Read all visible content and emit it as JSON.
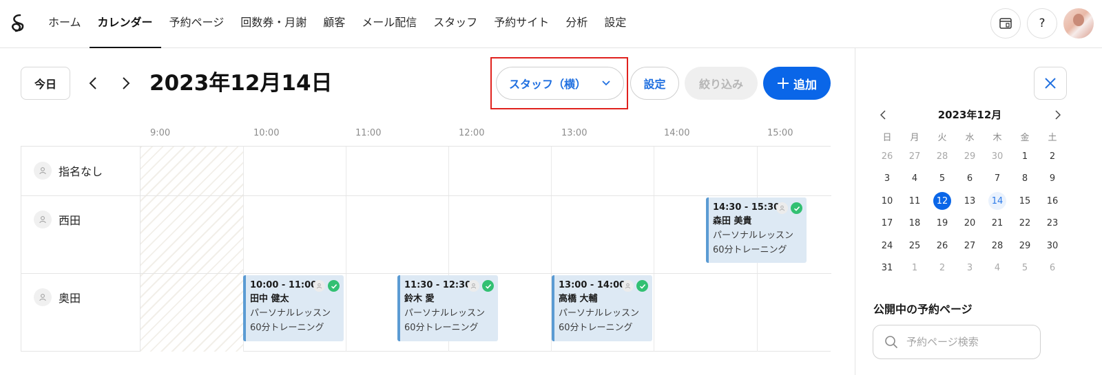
{
  "nav": {
    "items": [
      {
        "label": "ホーム",
        "active": false
      },
      {
        "label": "カレンダー",
        "active": true
      },
      {
        "label": "予約ページ",
        "active": false
      },
      {
        "label": "回数券・月謝",
        "active": false
      },
      {
        "label": "顧客",
        "active": false
      },
      {
        "label": "メール配信",
        "active": false
      },
      {
        "label": "スタッフ",
        "active": false
      },
      {
        "label": "予約サイト",
        "active": false
      },
      {
        "label": "分析",
        "active": false
      },
      {
        "label": "設定",
        "active": false
      }
    ],
    "help_label": "?",
    "icons": [
      "logo-icon",
      "browser-window-icon",
      "help-icon",
      "user-avatar"
    ]
  },
  "toolbar": {
    "today_label": "今日",
    "date_title": "2023年12月14日",
    "view_select": "スタッフ（横）",
    "settings_label": "設定",
    "filter_label": "絞り込み",
    "add_label": "追加"
  },
  "timeline": {
    "hours": [
      "9:00",
      "10:00",
      "11:00",
      "12:00",
      "13:00",
      "14:00",
      "15:00"
    ],
    "staff": [
      "指名なし",
      "西田",
      "奥田"
    ],
    "events": [
      {
        "staff": "西田",
        "time": "14:30 - 15:30",
        "customer": "森田 美貴",
        "line1": "パーソナルレッスン",
        "line2": "60分トレーニング",
        "confirmed": true
      },
      {
        "staff": "奥田",
        "time": "10:00 - 11:00",
        "customer": "田中 健太",
        "line1": "パーソナルレッスン",
        "line2": "60分トレーニング",
        "confirmed": true
      },
      {
        "staff": "奥田",
        "time": "11:30 - 12:30",
        "customer": "鈴木 愛",
        "line1": "パーソナルレッスン",
        "line2": "60分トレーニング",
        "confirmed": true
      },
      {
        "staff": "奥田",
        "time": "13:00 - 14:00",
        "customer": "高橋 大輔",
        "line1": "パーソナルレッスン",
        "line2": "60分トレーニング",
        "confirmed": true
      }
    ]
  },
  "mini_calendar": {
    "title": "2023年12月",
    "weekdays": [
      "日",
      "月",
      "火",
      "水",
      "木",
      "金",
      "土"
    ],
    "weeks": [
      [
        "26",
        "27",
        "28",
        "29",
        "30",
        "1",
        "2"
      ],
      [
        "3",
        "4",
        "5",
        "6",
        "7",
        "8",
        "9"
      ],
      [
        "10",
        "11",
        "12",
        "13",
        "14",
        "15",
        "16"
      ],
      [
        "17",
        "18",
        "19",
        "20",
        "21",
        "22",
        "23"
      ],
      [
        "24",
        "25",
        "26",
        "27",
        "28",
        "29",
        "30"
      ],
      [
        "31",
        "1",
        "2",
        "3",
        "4",
        "5",
        "6"
      ]
    ],
    "selected_day": "12",
    "highlighted_day": "14"
  },
  "public_pages": {
    "title": "公開中の予約ページ",
    "search_placeholder": "予約ページ検索"
  },
  "colors": {
    "accent": "#0a66e8",
    "event_bg": "#dde9f4",
    "event_border": "#5b9bd3",
    "confirmed": "#32c072",
    "highlight_frame": "#e0211d"
  }
}
